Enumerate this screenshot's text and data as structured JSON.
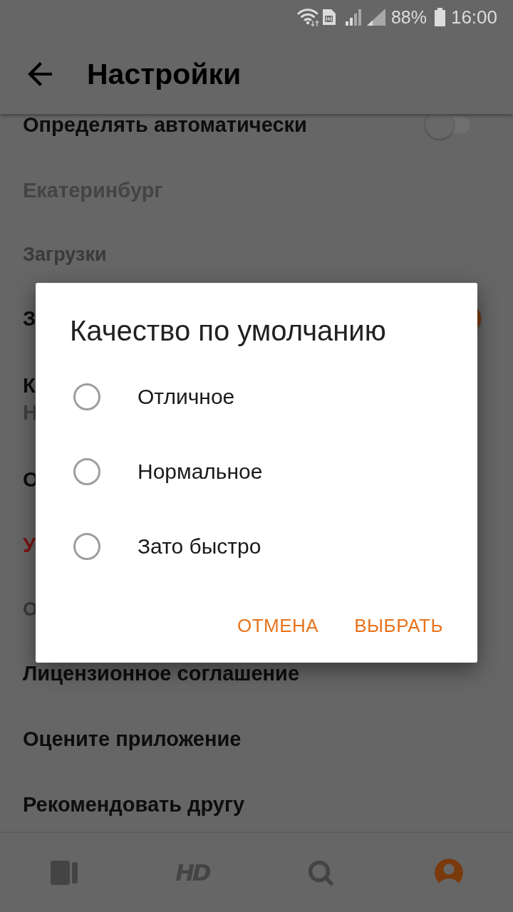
{
  "status_bar": {
    "battery": "88%",
    "time": "16:00"
  },
  "app_bar": {
    "title": "Настройки"
  },
  "settings": [
    {
      "kind": "switch",
      "label": "Определять автоматически",
      "checked": false
    },
    {
      "kind": "action",
      "label": "Екатеринбург",
      "disabled": true
    },
    {
      "kind": "header",
      "label": "Загрузки"
    },
    {
      "kind": "switch",
      "label": "З",
      "checked": true
    },
    {
      "kind": "detail",
      "label": "К",
      "value": "Н"
    },
    {
      "kind": "action",
      "label": "О",
      "disabled": false
    },
    {
      "kind": "danger",
      "label": "У"
    },
    {
      "kind": "header",
      "label": "О"
    },
    {
      "kind": "action",
      "label": "Лицензионное соглашение",
      "disabled": false
    },
    {
      "kind": "action",
      "label": "Оцените приложение",
      "disabled": false
    },
    {
      "kind": "action",
      "label": "Рекомендовать другу",
      "disabled": false
    }
  ],
  "bottom_nav": [
    {
      "kind": "cards",
      "selected": false
    },
    {
      "kind": "logo",
      "text": "HD",
      "selected": false
    },
    {
      "kind": "search",
      "selected": false
    },
    {
      "kind": "profile",
      "selected": true
    }
  ],
  "dialog": {
    "title": "Качество по умолчанию",
    "options": [
      {
        "label": "Отличное",
        "selected": false
      },
      {
        "label": "Нормальное",
        "selected": false
      },
      {
        "label": "Зато быстро",
        "selected": false
      }
    ],
    "buttons": [
      "ОТМЕНА",
      "ВЫБРАТЬ"
    ]
  }
}
